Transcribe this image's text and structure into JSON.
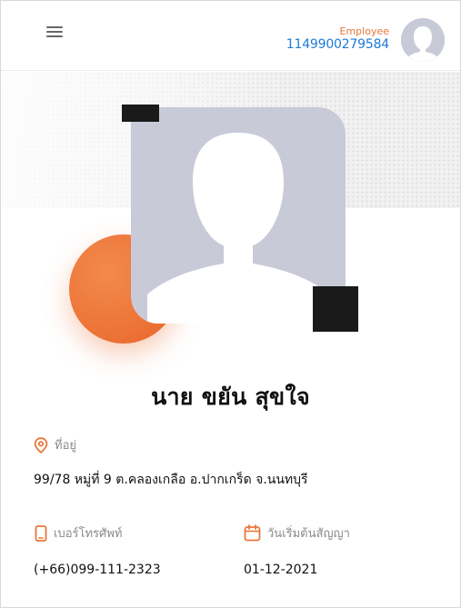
{
  "header": {
    "role_label": "Employee",
    "employee_id": "1149900279584"
  },
  "profile": {
    "name": "นาย ขยัน สุขใจ"
  },
  "address": {
    "label": "ที่อยู่",
    "value": "99/78 หมู่ที่ 9 ต.คลองเกลือ อ.ปากเกร็ด จ.นนทบุรี"
  },
  "phone": {
    "label": "เบอร์โทรศัพท์",
    "value": "(+66)099-111-2323"
  },
  "contract": {
    "label": "วันเริ่มต้นสัญญา",
    "value": "01-12-2021"
  },
  "colors": {
    "accent": "#e8773a",
    "link": "#1f7ad6",
    "placeholder": "#c9cad8",
    "dark": "#1a1a1a"
  },
  "icons": {
    "menu": "hamburger-menu-icon",
    "avatar": "user-silhouette-icon",
    "address": "location-pin-icon",
    "phone": "mobile-phone-icon",
    "contract": "calendar-icon"
  }
}
